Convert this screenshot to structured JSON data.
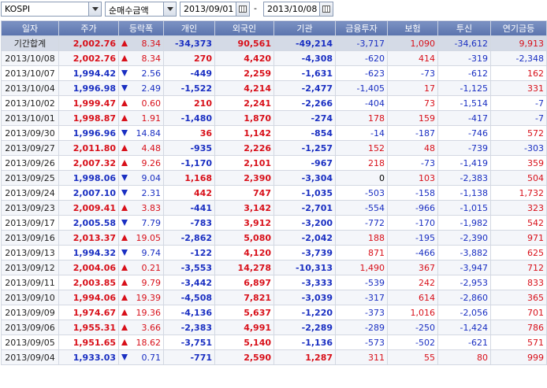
{
  "toolbar": {
    "market": "KOSPI",
    "metric": "순매수금액",
    "start_date": "2013/09/01",
    "separator": "-",
    "end_date": "2013/10/08"
  },
  "colors": {
    "up": "#d8101a",
    "down": "#1a2fc2",
    "header_bg": "#6a82b8"
  },
  "columns": [
    "일자",
    "주가",
    "등락폭",
    "개인",
    "외국인",
    "기관",
    "금융투자",
    "보험",
    "투신",
    "연기금등"
  ],
  "total": {
    "label": "기간합계",
    "price": "2,002.76",
    "dir": "up",
    "chg": "8.34",
    "indiv": "-34,373",
    "foreign": "90,561",
    "inst": "-49,214",
    "fin": "-3,717",
    "ins": "1,090",
    "trust": "-34,612",
    "pension": "9,913"
  },
  "rows": [
    {
      "date": "2013/10/08",
      "price": "2,002.76",
      "dir": "up",
      "chg": "8.34",
      "indiv": "270",
      "foreign": "4,420",
      "inst": "-4,308",
      "fin": "-620",
      "ins": "414",
      "trust": "-319",
      "pension": "-2,348"
    },
    {
      "date": "2013/10/07",
      "price": "1,994.42",
      "dir": "dn",
      "chg": "2.56",
      "indiv": "-449",
      "foreign": "2,259",
      "inst": "-1,631",
      "fin": "-623",
      "ins": "-73",
      "trust": "-612",
      "pension": "162"
    },
    {
      "date": "2013/10/04",
      "price": "1,996.98",
      "dir": "dn",
      "chg": "2.49",
      "indiv": "-1,522",
      "foreign": "4,214",
      "inst": "-2,477",
      "fin": "-1,405",
      "ins": "17",
      "trust": "-1,125",
      "pension": "331"
    },
    {
      "date": "2013/10/02",
      "price": "1,999.47",
      "dir": "up",
      "chg": "0.60",
      "indiv": "210",
      "foreign": "2,241",
      "inst": "-2,266",
      "fin": "-404",
      "ins": "73",
      "trust": "-1,514",
      "pension": "-7"
    },
    {
      "date": "2013/10/01",
      "price": "1,998.87",
      "dir": "up",
      "chg": "1.91",
      "indiv": "-1,480",
      "foreign": "1,870",
      "inst": "-274",
      "fin": "178",
      "ins": "159",
      "trust": "-417",
      "pension": "-7"
    },
    {
      "date": "2013/09/30",
      "price": "1,996.96",
      "dir": "dn",
      "chg": "14.84",
      "indiv": "36",
      "foreign": "1,142",
      "inst": "-854",
      "fin": "-14",
      "ins": "-187",
      "trust": "-746",
      "pension": "572"
    },
    {
      "date": "2013/09/27",
      "price": "2,011.80",
      "dir": "up",
      "chg": "4.48",
      "indiv": "-935",
      "foreign": "2,226",
      "inst": "-1,257",
      "fin": "152",
      "ins": "48",
      "trust": "-739",
      "pension": "-303"
    },
    {
      "date": "2013/09/26",
      "price": "2,007.32",
      "dir": "up",
      "chg": "9.26",
      "indiv": "-1,170",
      "foreign": "2,101",
      "inst": "-967",
      "fin": "218",
      "ins": "-73",
      "trust": "-1,419",
      "pension": "359"
    },
    {
      "date": "2013/09/25",
      "price": "1,998.06",
      "dir": "dn",
      "chg": "9.04",
      "indiv": "1,168",
      "foreign": "2,390",
      "inst": "-3,304",
      "fin": "0",
      "ins": "103",
      "trust": "-2,383",
      "pension": "504"
    },
    {
      "date": "2013/09/24",
      "price": "2,007.10",
      "dir": "dn",
      "chg": "2.31",
      "indiv": "442",
      "foreign": "747",
      "inst": "-1,035",
      "fin": "-503",
      "ins": "-158",
      "trust": "-1,138",
      "pension": "1,732"
    },
    {
      "date": "2013/09/23",
      "price": "2,009.41",
      "dir": "up",
      "chg": "3.83",
      "indiv": "-441",
      "foreign": "3,142",
      "inst": "-2,701",
      "fin": "-554",
      "ins": "-966",
      "trust": "-1,015",
      "pension": "323"
    },
    {
      "date": "2013/09/17",
      "price": "2,005.58",
      "dir": "dn",
      "chg": "7.79",
      "indiv": "-783",
      "foreign": "3,912",
      "inst": "-3,200",
      "fin": "-772",
      "ins": "-170",
      "trust": "-1,982",
      "pension": "542"
    },
    {
      "date": "2013/09/16",
      "price": "2,013.37",
      "dir": "up",
      "chg": "19.05",
      "indiv": "-2,862",
      "foreign": "5,080",
      "inst": "-2,042",
      "fin": "188",
      "ins": "-195",
      "trust": "-2,390",
      "pension": "971"
    },
    {
      "date": "2013/09/13",
      "price": "1,994.32",
      "dir": "dn",
      "chg": "9.74",
      "indiv": "-122",
      "foreign": "4,120",
      "inst": "-3,739",
      "fin": "871",
      "ins": "-466",
      "trust": "-3,882",
      "pension": "625"
    },
    {
      "date": "2013/09/12",
      "price": "2,004.06",
      "dir": "up",
      "chg": "0.21",
      "indiv": "-3,553",
      "foreign": "14,278",
      "inst": "-10,313",
      "fin": "1,490",
      "ins": "367",
      "trust": "-3,947",
      "pension": "712"
    },
    {
      "date": "2013/09/11",
      "price": "2,003.85",
      "dir": "up",
      "chg": "9.79",
      "indiv": "-3,442",
      "foreign": "6,897",
      "inst": "-3,333",
      "fin": "-539",
      "ins": "242",
      "trust": "-2,953",
      "pension": "833"
    },
    {
      "date": "2013/09/10",
      "price": "1,994.06",
      "dir": "up",
      "chg": "19.39",
      "indiv": "-4,508",
      "foreign": "7,821",
      "inst": "-3,039",
      "fin": "-317",
      "ins": "614",
      "trust": "-2,860",
      "pension": "365"
    },
    {
      "date": "2013/09/09",
      "price": "1,974.67",
      "dir": "up",
      "chg": "19.36",
      "indiv": "-4,136",
      "foreign": "5,637",
      "inst": "-1,220",
      "fin": "-373",
      "ins": "1,016",
      "trust": "-2,056",
      "pension": "701"
    },
    {
      "date": "2013/09/06",
      "price": "1,955.31",
      "dir": "up",
      "chg": "3.66",
      "indiv": "-2,383",
      "foreign": "4,991",
      "inst": "-2,289",
      "fin": "-289",
      "ins": "-250",
      "trust": "-1,424",
      "pension": "786"
    },
    {
      "date": "2013/09/05",
      "price": "1,951.65",
      "dir": "up",
      "chg": "18.62",
      "indiv": "-3,751",
      "foreign": "5,140",
      "inst": "-1,136",
      "fin": "-573",
      "ins": "-502",
      "trust": "-621",
      "pension": "571"
    },
    {
      "date": "2013/09/04",
      "price": "1,933.03",
      "dir": "dn",
      "chg": "0.71",
      "indiv": "-771",
      "foreign": "2,590",
      "inst": "1,287",
      "fin": "311",
      "ins": "55",
      "trust": "80",
      "pension": "999"
    }
  ]
}
